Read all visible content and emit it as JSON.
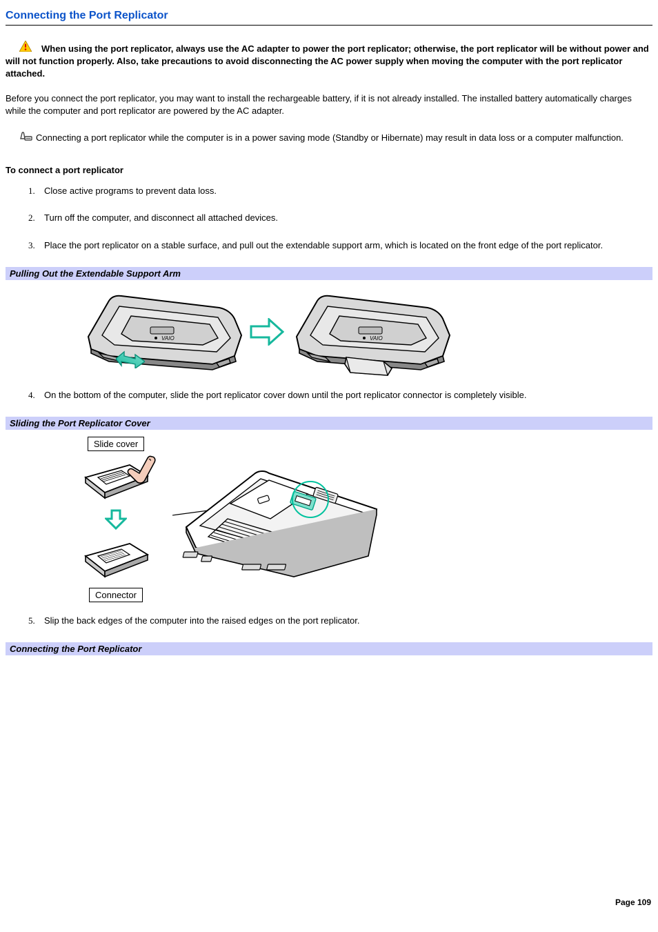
{
  "heading": "Connecting the Port Replicator",
  "caution": "When using the port replicator, always use the AC adapter to power the port replicator; otherwise, the port replicator will be without power and will not function properly. Also, take precautions to avoid disconnecting the AC power supply when moving the computer with the port replicator attached.",
  "intro": "Before you connect the port replicator, you may want to install the rechargeable battery, if it is not already installed. The installed battery automatically charges while the computer and port replicator are powered by the AC adapter.",
  "note": "Connecting a port replicator while the computer is in a power saving mode (Standby or Hibernate) may result in data loss or a computer malfunction.",
  "subheading": "To connect a port replicator",
  "steps": [
    "Close active programs to prevent data loss.",
    "Turn off the computer, and disconnect all attached devices.",
    "Place the port replicator on a stable surface, and pull out the extendable support arm, which is located on the front edge of the port replicator.",
    "On the bottom of the computer, slide the port replicator cover down until the port replicator connector is completely visible.",
    "Slip the back edges of the computer into the raised edges on the port replicator."
  ],
  "caption1": "Pulling Out the Extendable Support Arm",
  "caption2": "Sliding the Port Replicator Cover",
  "caption3": "Connecting the Port Replicator",
  "slide_label": "Slide cover",
  "connector_label": "Connector",
  "page_footer": "Page 109"
}
